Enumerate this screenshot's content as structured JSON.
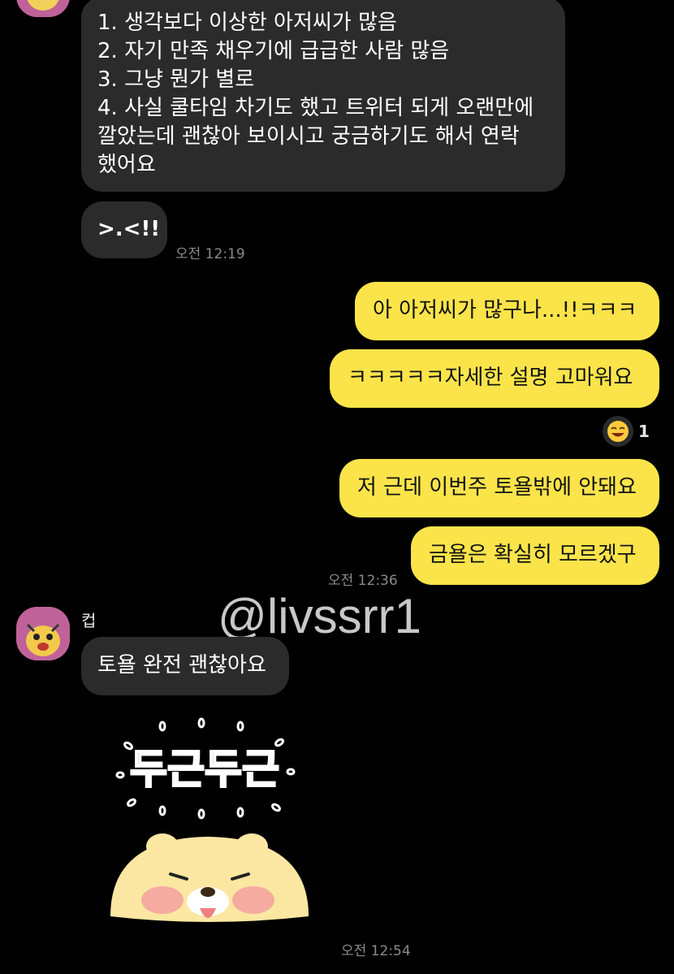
{
  "messages": {
    "m1": {
      "lines": [
        "1. 생각보다 이상한 아저씨가 많음",
        "2. 자기 만족 채우기에 급급한 사람 많음",
        "3. 그냥 뭔가 별로",
        "4. 사실 쿨타임 차기도 했고 트위터 되게 오랜만에",
        "깔았는데 괜찮아 보이시고 궁금하기도 해서 연락",
        "했어요"
      ]
    },
    "m2": {
      "text": ">.<!!",
      "time": "오전 12:19"
    },
    "m3": {
      "text": "아 아저씨가 많구나...!!ㅋㅋㅋ"
    },
    "m4": {
      "text": "ㅋㅋㅋㅋㅋ자세한 설명 고마워요",
      "reaction_count": "1",
      "reaction_icon": "laughing-face-icon"
    },
    "m5": {
      "text": "저 근데 이번주 토욜밖에 안돼요"
    },
    "m6": {
      "text": "금욜은 확실히 모르겠구",
      "time": "오전 12:36"
    },
    "m7": {
      "sender": "컵",
      "text": "토욜 완전 괜찮아요"
    },
    "m8": {
      "sticker_text": "두근두근",
      "time": "오전 12:54"
    }
  },
  "watermark": "@livssrr1",
  "colors": {
    "background": "#000000",
    "incoming_bubble": "#2b2b2b",
    "outgoing_bubble": "#fae44a",
    "avatar": "#c0629a",
    "sticker": "#fbe7a2"
  }
}
